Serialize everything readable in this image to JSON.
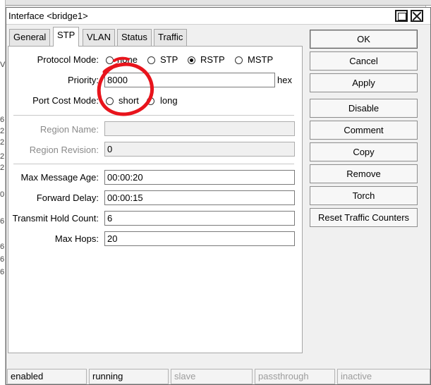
{
  "window": {
    "title": "Interface <bridge1>"
  },
  "tabs": [
    {
      "label": "General"
    },
    {
      "label": "STP"
    },
    {
      "label": "VLAN"
    },
    {
      "label": "Status"
    },
    {
      "label": "Traffic"
    }
  ],
  "stp": {
    "protocol_mode": {
      "label": "Protocol Mode:",
      "options": [
        "none",
        "STP",
        "RSTP",
        "MSTP"
      ],
      "selected": "RSTP"
    },
    "priority": {
      "label": "Priority:",
      "value": "8000",
      "suffix": "hex"
    },
    "port_cost_mode": {
      "label": "Port Cost Mode:",
      "options": [
        "short",
        "long"
      ],
      "selected": ""
    },
    "region_name": {
      "label": "Region Name:",
      "value": ""
    },
    "region_revision": {
      "label": "Region Revision:",
      "value": "0"
    },
    "max_message_age": {
      "label": "Max Message Age:",
      "value": "00:00:20"
    },
    "forward_delay": {
      "label": "Forward Delay:",
      "value": "00:00:15"
    },
    "transmit_hold_count": {
      "label": "Transmit Hold Count:",
      "value": "6"
    },
    "max_hops": {
      "label": "Max Hops:",
      "value": "20"
    }
  },
  "buttons": {
    "ok": "OK",
    "cancel": "Cancel",
    "apply": "Apply",
    "disable": "Disable",
    "comment": "Comment",
    "copy": "Copy",
    "remove": "Remove",
    "torch": "Torch",
    "reset_traffic_counters": "Reset Traffic Counters"
  },
  "statusbar": [
    "enabled",
    "running",
    "slave",
    "passthrough",
    "inactive"
  ],
  "background": {
    "left_marks": [
      "Vl",
      "6",
      "2",
      "2",
      "2",
      "2",
      "0",
      "6",
      "6",
      "6",
      "6"
    ]
  },
  "colors": {
    "annotation": "#e8141c",
    "disabled_text": "#8a8a8a"
  }
}
